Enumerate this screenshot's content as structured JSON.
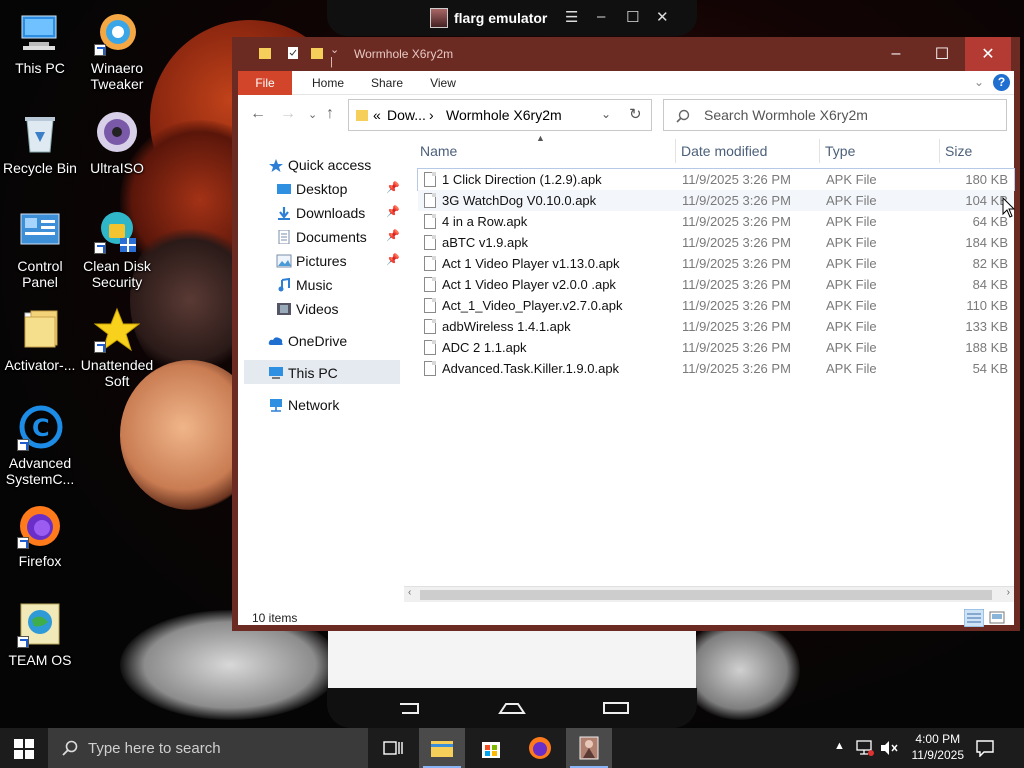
{
  "desktop_icons": [
    {
      "label": "This PC",
      "icon": "this-pc-icon"
    },
    {
      "label": "Winaero Tweaker",
      "icon": "winaero-icon"
    },
    {
      "label": "Recycle Bin",
      "icon": "recycle-bin-icon"
    },
    {
      "label": "UltraISO",
      "icon": "ultraiso-icon"
    },
    {
      "label": "Control Panel",
      "icon": "control-panel-icon"
    },
    {
      "label": "Clean Disk Security",
      "icon": "clean-disk-icon"
    },
    {
      "label": "Activator-...",
      "icon": "folder-icon"
    },
    {
      "label": "Unattended Soft",
      "icon": "star-icon"
    },
    {
      "label": "Advanced SystemC...",
      "icon": "advanced-systemcare-icon"
    },
    {
      "label": "Firefox",
      "icon": "firefox-icon"
    },
    {
      "label": "TEAM OS",
      "icon": "team-os-icon"
    }
  ],
  "emulator": {
    "title": "flarg emulator"
  },
  "explorer": {
    "title": "Wormhole X6ry2m",
    "ribbon_tabs": [
      "File",
      "Home",
      "Share",
      "View"
    ],
    "address": {
      "prefix": "«",
      "crumb1": "Dow...",
      "separator": "›",
      "crumb2": "Wormhole X6ry2m"
    },
    "search_placeholder": "Search Wormhole X6ry2m",
    "nav": [
      {
        "label": "Quick access"
      },
      {
        "label": "Desktop"
      },
      {
        "label": "Downloads"
      },
      {
        "label": "Documents"
      },
      {
        "label": "Pictures"
      },
      {
        "label": "Music"
      },
      {
        "label": "Videos"
      },
      {
        "label": "OneDrive"
      },
      {
        "label": "This PC"
      },
      {
        "label": "Network"
      }
    ],
    "columns": [
      "Name",
      "Date modified",
      "Type",
      "Size"
    ],
    "files": [
      {
        "name": "1 Click Direction (1.2.9).apk",
        "date": "11/9/2025 3:26 PM",
        "type": "APK File",
        "size": "180 KB"
      },
      {
        "name": "3G WatchDog V0.10.0.apk",
        "date": "11/9/2025 3:26 PM",
        "type": "APK File",
        "size": "104 KB"
      },
      {
        "name": "4 in a Row.apk",
        "date": "11/9/2025 3:26 PM",
        "type": "APK File",
        "size": "64 KB"
      },
      {
        "name": "aBTC v1.9.apk",
        "date": "11/9/2025 3:26 PM",
        "type": "APK File",
        "size": "184 KB"
      },
      {
        "name": "Act 1 Video Player v1.13.0.apk",
        "date": "11/9/2025 3:26 PM",
        "type": "APK File",
        "size": "82 KB"
      },
      {
        "name": "Act 1 Video Player v2.0.0 .apk",
        "date": "11/9/2025 3:26 PM",
        "type": "APK File",
        "size": "84 KB"
      },
      {
        "name": "Act_1_Video_Player.v2.7.0.apk",
        "date": "11/9/2025 3:26 PM",
        "type": "APK File",
        "size": "110 KB"
      },
      {
        "name": "adbWireless 1.4.1.apk",
        "date": "11/9/2025 3:26 PM",
        "type": "APK File",
        "size": "133 KB"
      },
      {
        "name": "ADC 2 1.1.apk",
        "date": "11/9/2025 3:26 PM",
        "type": "APK File",
        "size": "188 KB"
      },
      {
        "name": "Advanced.Task.Killer.1.9.0.apk",
        "date": "11/9/2025 3:26 PM",
        "type": "APK File",
        "size": "54 KB"
      }
    ],
    "status": "10 items"
  },
  "taskbar": {
    "search_placeholder": "Type here to search",
    "time": "4:00 PM",
    "date": "11/9/2025"
  },
  "colors": {
    "titlebar": "#6b2a22",
    "file_tab": "#d3452a",
    "close": "#b33b33",
    "taskbar": "#1c1c1c"
  }
}
